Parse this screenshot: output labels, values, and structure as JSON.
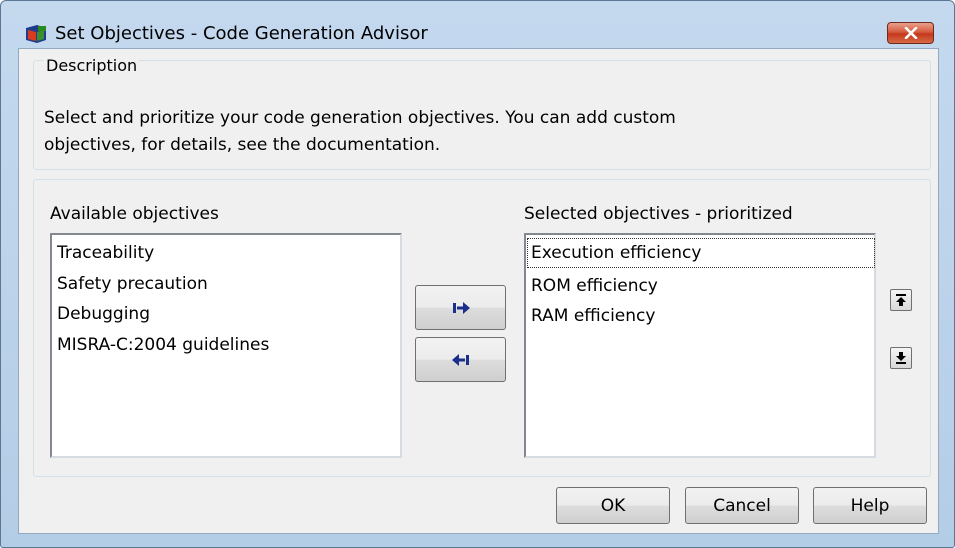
{
  "window": {
    "title": "Set Objectives - Code Generation Advisor"
  },
  "description": {
    "group_label": "Description",
    "text": "Select and prioritize your code generation objectives. You can add custom\nobjectives, for details, see the documentation."
  },
  "available": {
    "label": "Available objectives",
    "items": [
      "Traceability",
      "Safety precaution",
      "Debugging",
      "MISRA-C:2004 guidelines"
    ]
  },
  "selected": {
    "label": "Selected objectives - prioritized",
    "items": [
      "Execution efficiency",
      "ROM efficiency",
      "RAM efficiency"
    ],
    "focused_item": "Execution efficiency"
  },
  "buttons": {
    "ok": "OK",
    "cancel": "Cancel",
    "help": "Help"
  },
  "icons": {
    "app": "simulink-app-icon",
    "close": "close-icon",
    "add": "arrow-right-bar-icon",
    "remove": "arrow-left-bar-icon",
    "move_up": "move-to-top-icon",
    "move_down": "move-to-bottom-icon"
  },
  "colors": {
    "titlebar": "#b9d1ea",
    "close_button": "#c7462b",
    "arrow_icon": "#1a2f8c"
  }
}
